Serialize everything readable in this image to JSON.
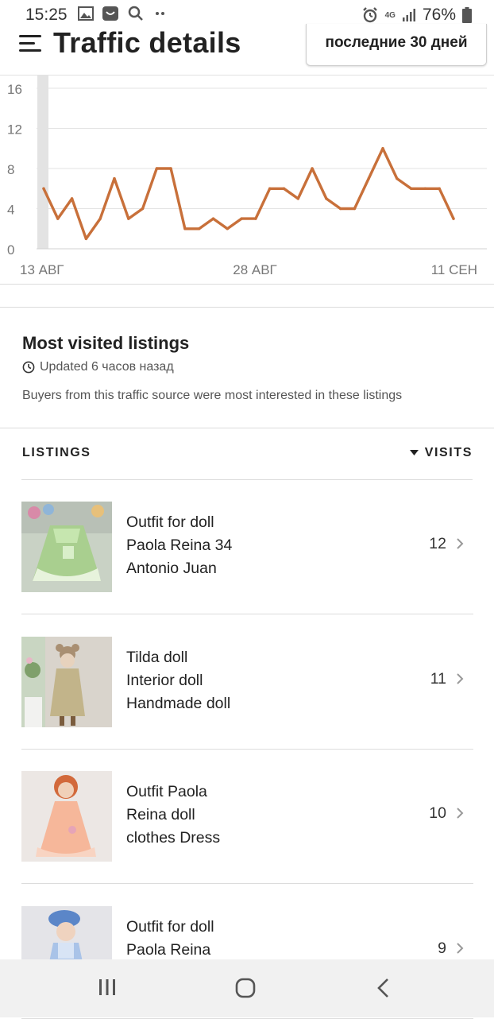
{
  "status_bar": {
    "time": "15:25",
    "network": "4G",
    "battery_percent": "76%",
    "icons_left": [
      "gallery-icon",
      "messenger-icon",
      "search-icon",
      "more-dots-icon"
    ],
    "icons_right": [
      "alarm-icon",
      "4g-icon",
      "signal-icon",
      "battery-icon"
    ]
  },
  "header": {
    "title": "Traffic details",
    "date_range": "последние 30 дней"
  },
  "chart_data": {
    "type": "line",
    "color": "#c8703a",
    "x_tick_labels": [
      "13 АВГ",
      "28 АВГ",
      "11 СЕН"
    ],
    "y_ticks": [
      0,
      4,
      8,
      12,
      16
    ],
    "ylim": [
      0,
      16
    ],
    "grid": true,
    "highlight_index": 0,
    "values": [
      6,
      3,
      5,
      1,
      3,
      7,
      3,
      4,
      8,
      8,
      2,
      2,
      3,
      2,
      3,
      3,
      6,
      6,
      5,
      8,
      5,
      4,
      4,
      7,
      10,
      7,
      6,
      6,
      6,
      3
    ]
  },
  "most_visited": {
    "title": "Most visited listings",
    "updated": "Updated 6 часов назад",
    "description": "Buyers from this traffic source were most interested in these listings"
  },
  "list_header": {
    "left": "LISTINGS",
    "right": "VISITS"
  },
  "listings": [
    {
      "lines": [
        "Outfit for doll",
        "Paola Reina 34",
        "Antonio Juan"
      ],
      "visits": "12"
    },
    {
      "lines": [
        "Tilda doll",
        "Interior doll",
        "Handmade doll"
      ],
      "visits": "11"
    },
    {
      "lines": [
        "Outfit Paola",
        "Reina doll",
        "clothes Dress"
      ],
      "visits": "10"
    },
    {
      "lines": [
        "Outfit for doll",
        "Paola Reina",
        ""
      ],
      "visits": "9"
    }
  ]
}
